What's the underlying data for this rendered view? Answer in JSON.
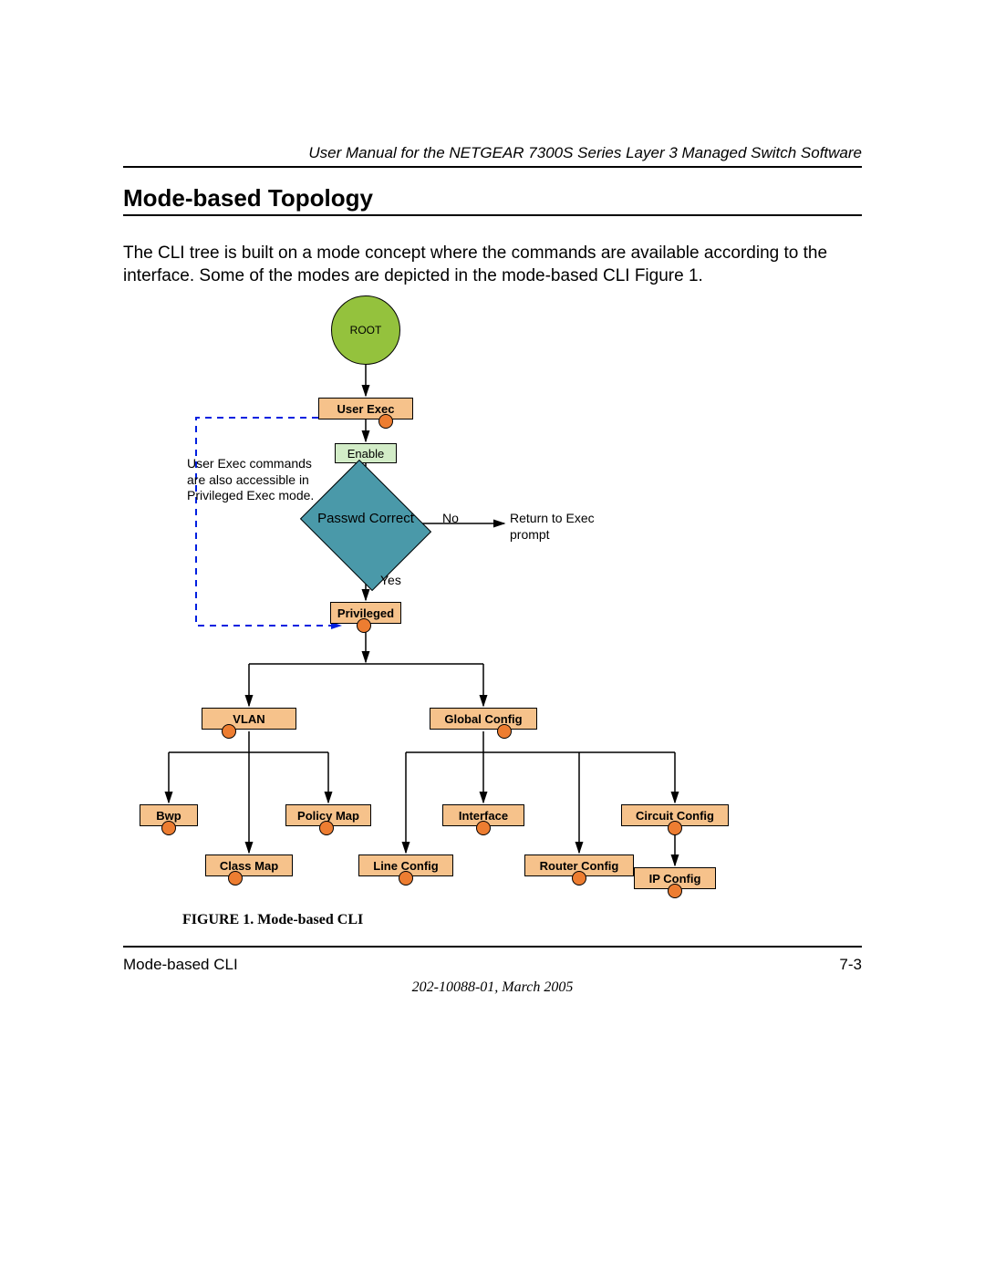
{
  "header": "User Manual for the NETGEAR 7300S Series Layer 3 Managed Switch Software",
  "section_title": "Mode-based Topology",
  "body_text": "The CLI tree is built on a mode concept where the commands are available according to the interface. Some of the modes are depicted in the mode-based CLI Figure 1.",
  "figure_caption": "FIGURE 1.  Mode-based CLI",
  "footer_left": "Mode-based CLI",
  "footer_right": "7-3",
  "footer_center": "202-10088-01, March 2005",
  "diagram": {
    "root": "ROOT",
    "user_exec": "User Exec",
    "enable": "Enable",
    "passwd": "Passwd Correct",
    "privileged": "Privileged",
    "vlan": "VLAN",
    "global_config": "Global Config",
    "bwp": "Bwp",
    "policy_map": "Policy Map",
    "interface": "Interface",
    "circuit_config": "Circuit Config",
    "class_map": "Class Map",
    "line_config": "Line Config",
    "router_config": "Router Config",
    "ip_config": "IP Config",
    "label_no": "No",
    "label_yes": "Yes",
    "note_left": "User Exec commands are also accessible in Privileged Exec mode.",
    "note_right": "Return to Exec prompt"
  }
}
